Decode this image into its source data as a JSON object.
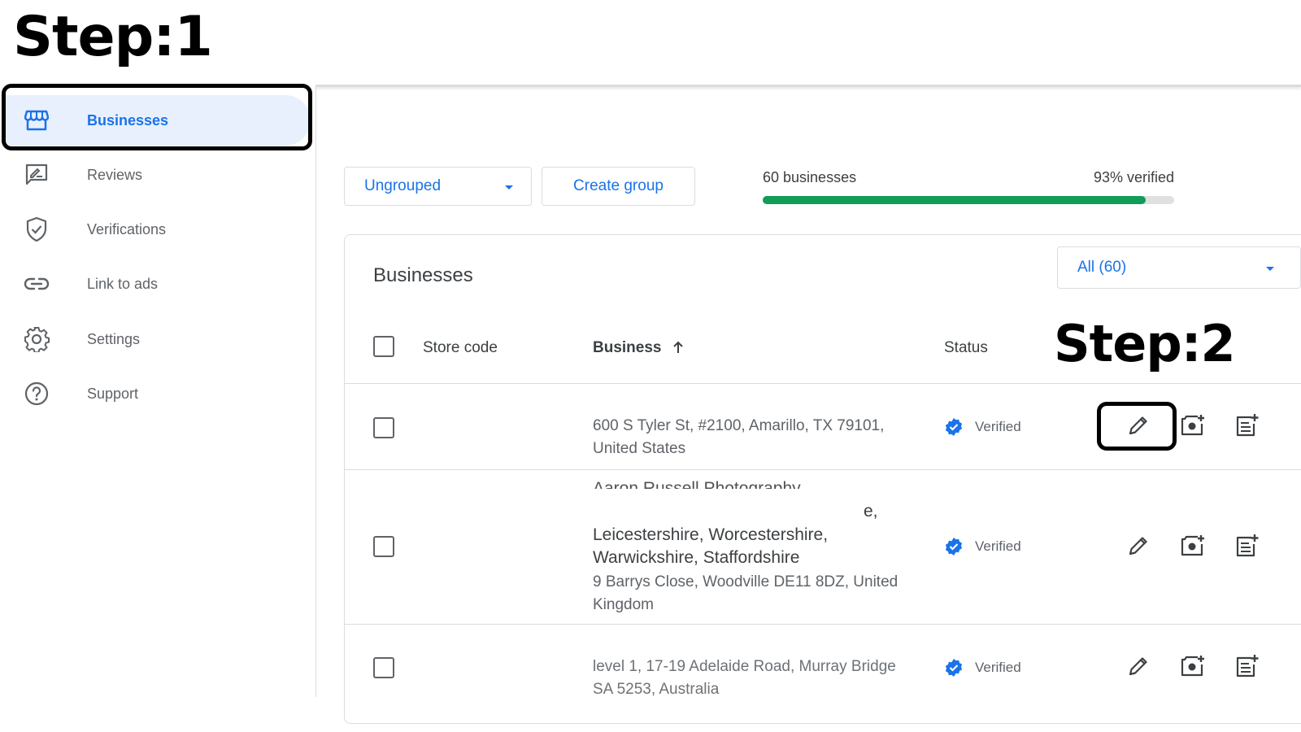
{
  "annotations": {
    "step1": "Step:1",
    "step2": "Step:2"
  },
  "sidebar": {
    "items": [
      {
        "label": "Businesses",
        "icon": "storefront-icon",
        "active": true
      },
      {
        "label": "Reviews",
        "icon": "review-icon",
        "active": false
      },
      {
        "label": "Verifications",
        "icon": "shield-check-icon",
        "active": false
      },
      {
        "label": "Link to ads",
        "icon": "link-icon",
        "active": false
      },
      {
        "label": "Settings",
        "icon": "gear-icon",
        "active": false
      },
      {
        "label": "Support",
        "icon": "help-icon",
        "active": false
      }
    ]
  },
  "toolbar": {
    "group_select": "Ungrouped",
    "create_group": "Create group",
    "business_count": "60 businesses",
    "verified_pct_label": "93% verified",
    "verified_fraction": 0.93
  },
  "card": {
    "title": "Businesses",
    "filter": "All (60)",
    "columns": {
      "store_code": "Store code",
      "business": "Business",
      "status": "Status"
    },
    "rows": [
      {
        "name_lines": [],
        "address_lines": [
          "600 S Tyler St, #2100, Amarillo, TX 79101,",
          "United States"
        ],
        "status": "Verified"
      },
      {
        "name_lines": [
          "Aaron Russell Photography",
          "e,",
          "Leicestershire, Worcestershire,",
          "Warwickshire, Staffordshire"
        ],
        "address_lines": [
          "9 Barrys Close, Woodville DE11 8DZ, United",
          "Kingdom"
        ],
        "status": "Verified"
      },
      {
        "name_lines": [
          "level 1, 17-19 Adelaide Road, Murray Bridge"
        ],
        "address_lines": [
          "SA 5253, Australia"
        ],
        "status": "Verified"
      }
    ]
  },
  "colors": {
    "accent": "#1a73e8",
    "progress": "#0f9d58",
    "active_bg": "#e8f0fe"
  }
}
